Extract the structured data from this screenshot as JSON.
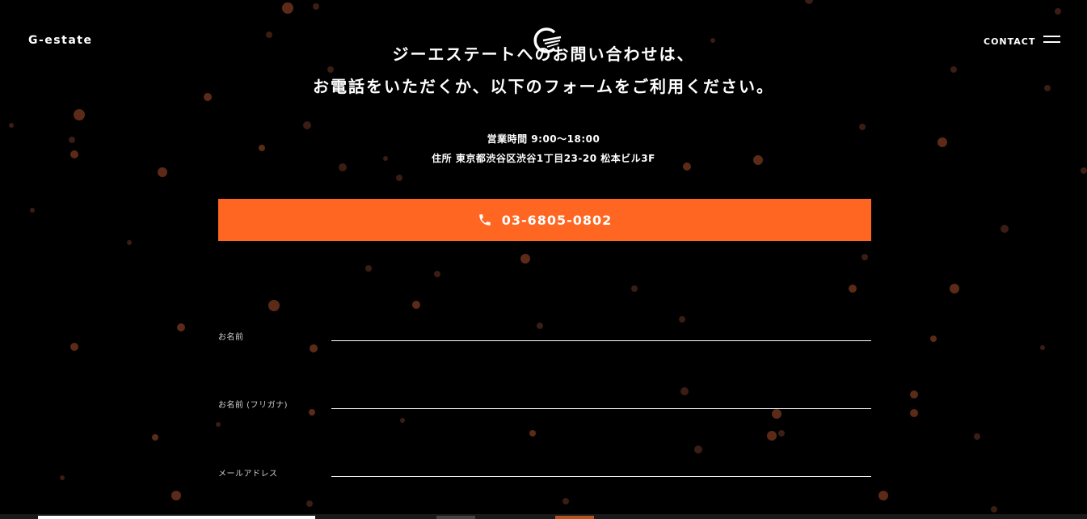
{
  "header": {
    "brand": "G-estate",
    "contact_label": "CONTACT",
    "logo_icon": "g-swirl-logo-icon",
    "menu_icon": "hamburger-menu-icon"
  },
  "lead": {
    "line1": "ジーエステートへのお問い合わせは、",
    "line2": "お電話をいただくか、以下のフォームをご利用ください。"
  },
  "info": {
    "hours": "営業時間 9:00〜18:00",
    "address": "住所 東京都渋谷区渋谷1丁目23-20 松本ビル3F"
  },
  "phone": {
    "number": "03-6805-0802",
    "icon": "phone-icon"
  },
  "form": {
    "fields": [
      {
        "label": "お名前",
        "value": ""
      },
      {
        "label": "お名前 (フリガナ)",
        "value": ""
      },
      {
        "label": "メールアドレス",
        "value": ""
      }
    ]
  },
  "colors": {
    "accent": "#ff6621",
    "background": "#000000",
    "text": "#ffffff"
  }
}
